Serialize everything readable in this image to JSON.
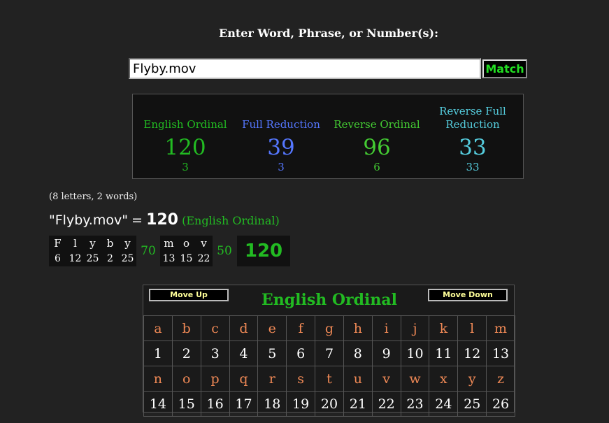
{
  "prompt": "Enter Word, Phrase, or Number(s):",
  "search": {
    "value": "Flyby.mov"
  },
  "match_label": "Match",
  "ciphers": [
    {
      "name": "English Ordinal",
      "value": "120",
      "sub": "3",
      "color": "#22bb22"
    },
    {
      "name": "Full Reduction",
      "value": "39",
      "sub": "3",
      "color": "#5577ff"
    },
    {
      "name": "Reverse Ordinal",
      "value": "96",
      "sub": "6",
      "color": "#44cc33"
    },
    {
      "name": "Reverse Full Reduction",
      "value": "33",
      "sub": "33",
      "color": "#55ccdd"
    }
  ],
  "stats": "(8 letters, 2 words)",
  "summary": {
    "phrase": "\"Flyby.mov\"",
    "equals": "=",
    "total": "120",
    "cipher": "(English Ordinal)"
  },
  "breakdown": {
    "words": [
      {
        "letters": [
          {
            "l": "F",
            "n": "6"
          },
          {
            "l": "l",
            "n": "12"
          },
          {
            "l": "y",
            "n": "25"
          },
          {
            "l": "b",
            "n": "2"
          },
          {
            "l": "y",
            "n": "25"
          }
        ],
        "sum": "70"
      },
      {
        "letters": [
          {
            "l": "m",
            "n": "13"
          },
          {
            "l": "o",
            "n": "15"
          },
          {
            "l": "v",
            "n": "22"
          }
        ],
        "sum": "50"
      }
    ],
    "total": "120"
  },
  "chart": {
    "move_up": "Move Up",
    "move_down": "Move Down",
    "title": "English Ordinal",
    "rows": [
      {
        "letters": [
          "a",
          "b",
          "c",
          "d",
          "e",
          "f",
          "g",
          "h",
          "i",
          "j",
          "k",
          "l",
          "m"
        ],
        "values": [
          "1",
          "2",
          "3",
          "4",
          "5",
          "6",
          "7",
          "8",
          "9",
          "10",
          "11",
          "12",
          "13"
        ]
      },
      {
        "letters": [
          "n",
          "o",
          "p",
          "q",
          "r",
          "s",
          "t",
          "u",
          "v",
          "w",
          "x",
          "y",
          "z"
        ],
        "values": [
          "14",
          "15",
          "16",
          "17",
          "18",
          "19",
          "20",
          "21",
          "22",
          "23",
          "24",
          "25",
          "26"
        ]
      }
    ]
  }
}
